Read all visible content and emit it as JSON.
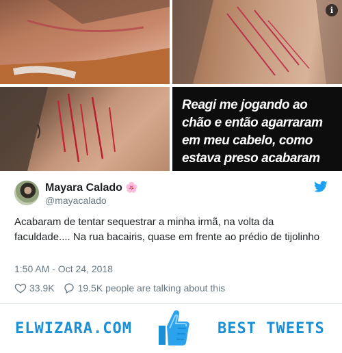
{
  "media": {
    "caption_lines": [
      "Reagi me jogando ao",
      "chão e então agarraram",
      "em meu cabelo, como",
      "estava preso acabaram"
    ],
    "info_glyph": "i"
  },
  "tweet": {
    "name": "Mayara Calado",
    "name_emoji": "🌸",
    "handle": "@mayacalado",
    "text": "Acabaram de tentar sequestrar a minha irmã, na volta da faculdade.... Na rua bacairis, quase em frente ao prédio de tijolinho",
    "timestamp": "1:50 AM - Oct 24, 2018",
    "likes": "33.9K",
    "talking": "19.5K people are talking about this"
  },
  "footer": {
    "brand": "ELWIZARA.COM",
    "tagline": "BEST TWEETS"
  },
  "colors": {
    "twitter_blue": "#1da1f2",
    "brand_blue": "#1a8fd6",
    "muted": "#697882"
  }
}
